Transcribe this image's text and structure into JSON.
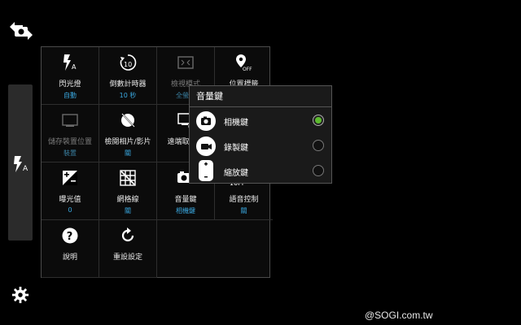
{
  "side": {
    "switch_icon": "camera-switch-icon",
    "flash_icon": "flash-auto-icon",
    "settings_icon": "gear-icon"
  },
  "grid": {
    "cells": [
      {
        "label": "閃光燈",
        "value": "自動",
        "icon": "flash-auto-icon"
      },
      {
        "label": "倒數計時器",
        "value": "10 秒",
        "icon": "timer-icon"
      },
      {
        "label": "檢視模式",
        "value": "全螢幕",
        "icon": "view-mode-icon"
      },
      {
        "label": "位置標籤",
        "value": "",
        "icon": "location-off-icon"
      },
      {
        "label": "儲存裝置位置",
        "value": "裝置",
        "icon": "storage-icon"
      },
      {
        "label": "檢閱相片/影片",
        "value": "關",
        "icon": "review-off-icon"
      },
      {
        "label": "遠端取景器",
        "value": "",
        "icon": "remote-viewfinder-icon"
      },
      {
        "label": "",
        "value": "",
        "icon": ""
      },
      {
        "label": "曝光值",
        "value": "0",
        "icon": "exposure-icon"
      },
      {
        "label": "網格線",
        "value": "關",
        "icon": "grid-lines-icon"
      },
      {
        "label": "音量鍵",
        "value": "相機鍵",
        "icon": "volume-key-icon"
      },
      {
        "label": "語音控制",
        "value": "關",
        "icon": "voice-control-icon"
      },
      {
        "label": "說明",
        "value": "",
        "icon": "help-icon"
      },
      {
        "label": "重設設定",
        "value": "",
        "icon": "reset-icon"
      }
    ]
  },
  "popup": {
    "title": "音量鍵",
    "options": [
      {
        "label": "相機鍵",
        "icon": "camera-icon",
        "selected": true
      },
      {
        "label": "錄製鍵",
        "icon": "video-icon",
        "selected": false
      },
      {
        "label": "縮放鍵",
        "icon": "zoom-icon",
        "selected": false
      }
    ]
  },
  "voice_peek": "10FF",
  "watermark": "@SOGI.com.tw",
  "colors": {
    "accent_value": "#3aa8e0",
    "selected_radio": "#5dbb2f",
    "background": "#000000"
  }
}
